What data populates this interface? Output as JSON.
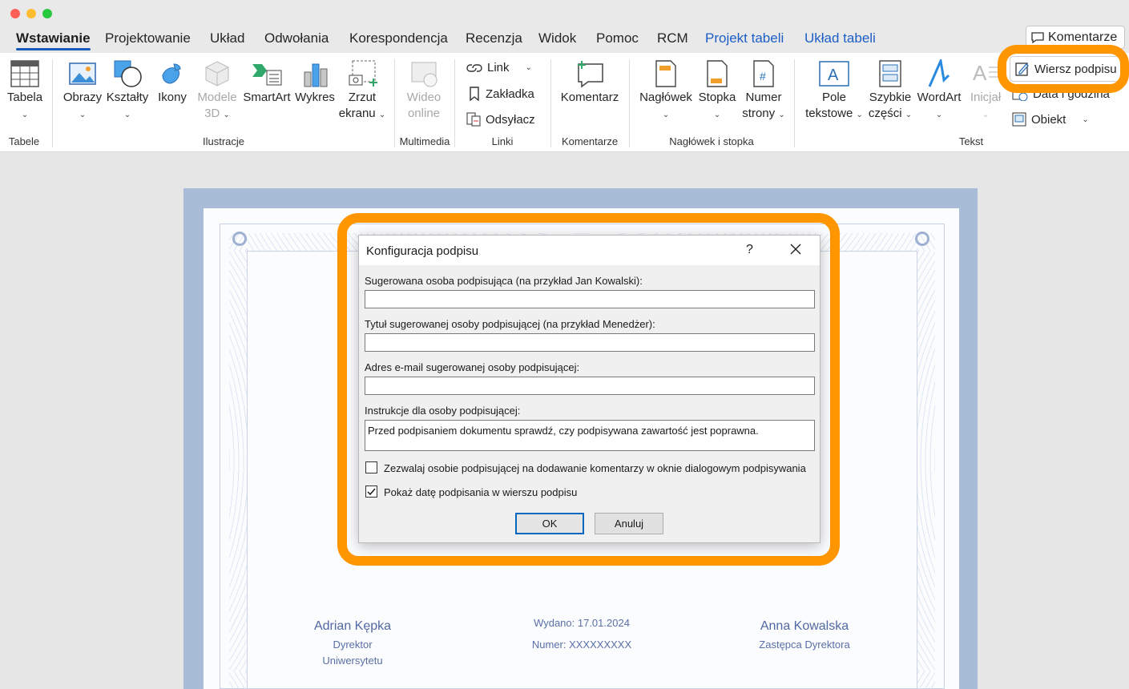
{
  "tabs": [
    {
      "label": "Wstawianie",
      "active": true
    },
    {
      "label": "Projektowanie"
    },
    {
      "label": "Układ"
    },
    {
      "label": "Odwołania"
    },
    {
      "label": "Korespondencja"
    },
    {
      "label": "Recenzja"
    },
    {
      "label": "Widok"
    },
    {
      "label": "Pomoc"
    },
    {
      "label": "RCM"
    },
    {
      "label": "Projekt tabeli",
      "contextual": true
    },
    {
      "label": "Układ tabeli",
      "contextual": true
    }
  ],
  "comments_button": "Komentarze",
  "ribbon": {
    "tabela": {
      "line1": "Tabela"
    },
    "obrazy": "Obrazy",
    "ksztalty": "Kształty",
    "ikony": "Ikony",
    "modele": {
      "line1": "Modele",
      "line2": "3D"
    },
    "smartart": "SmartArt",
    "wykres": "Wykres",
    "zrzut": {
      "line1": "Zrzut",
      "line2": "ekranu"
    },
    "wideo": {
      "line1": "Wideo",
      "line2": "online"
    },
    "link": "Link",
    "zakladka": "Zakładka",
    "odsylacz": "Odsyłacz",
    "komentarz": "Komentarz",
    "naglowek": "Nagłówek",
    "stopka": "Stopka",
    "numer": {
      "line1": "Numer",
      "line2": "strony"
    },
    "pole": {
      "line1": "Pole",
      "line2": "tekstowe"
    },
    "szybkie": {
      "line1": "Szybkie",
      "line2": "części"
    },
    "wordart": "WordArt",
    "inicjal": "Inicjał",
    "wiersz_podpisu": "Wiersz podpisu",
    "data_godzina": "Data i godzina",
    "obiekt": "Obiekt",
    "groups": {
      "tabele": "Tabele",
      "ilustracje": "Ilustracje",
      "multimedia": "Multimedia",
      "linki": "Linki",
      "komentarze": "Komentarze",
      "naglowek_stopka": "Nagłówek i stopka",
      "tekst": "Tekst"
    }
  },
  "certificate": {
    "left_name": "Adrian Kępka",
    "left_role1": "Dyrektor",
    "left_role2": "Uniwersytetu",
    "issued": "Wydano: 17.01.2024",
    "number": "Numer: XXXXXXXXX",
    "right_name": "Anna Kowalska",
    "right_role": "Zastępca Dyrektora"
  },
  "dialog": {
    "title": "Konfiguracja podpisu",
    "help": "?",
    "fields": {
      "signer_label": "Sugerowana osoba podpisująca (na przykład Jan Kowalski):",
      "signer_value": "",
      "title_label": "Tytuł sugerowanej osoby podpisującej (na przykład Menedżer):",
      "title_value": "",
      "email_label": "Adres e-mail sugerowanej osoby podpisującej:",
      "email_value": "",
      "instructions_label": "Instrukcje dla osoby podpisującej:",
      "instructions_value": "Przed podpisaniem dokumentu sprawdź, czy podpisywana zawartość jest poprawna."
    },
    "allow_comments": {
      "label": "Zezwalaj osobie podpisującej na dodawanie komentarzy w oknie dialogowym podpisywania",
      "checked": false
    },
    "show_date": {
      "label": "Pokaż datę podpisania w wierszu podpisu",
      "checked": true
    },
    "ok": "OK",
    "cancel": "Anuluj"
  },
  "colors": {
    "accent": "#185abd",
    "highlight": "#ff9600",
    "contextual_tab": "#1c5ec6"
  }
}
